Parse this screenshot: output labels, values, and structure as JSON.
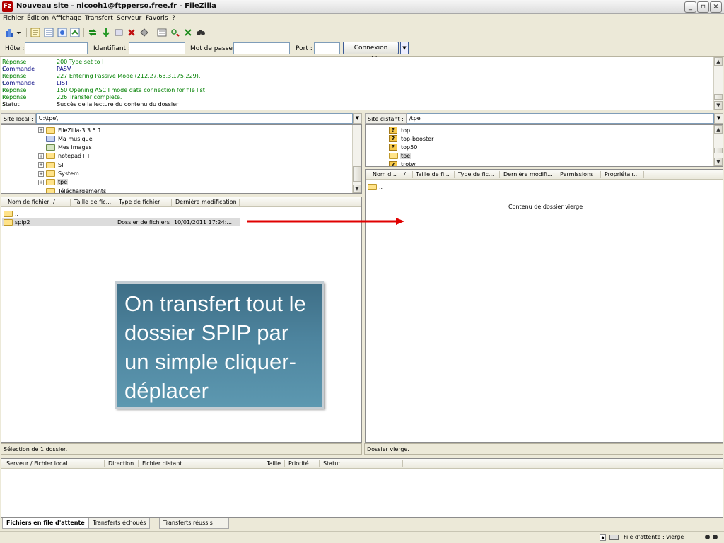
{
  "window": {
    "title": "Nouveau site - nicooh1@ftpperso.free.fr - FileZilla",
    "app_icon_letter": "Fz",
    "buttons": {
      "minimize": "_",
      "restore": "▫",
      "close": "×"
    }
  },
  "menu": [
    "Fichier",
    "Édition",
    "Affichage",
    "Transfert",
    "Serveur",
    "Favoris",
    "?"
  ],
  "toolbar_icons": [
    "site-manager-icon",
    "site-manager-dropdown-icon",
    "toggle-log-icon",
    "toggle-local-tree-icon",
    "toggle-remote-tree-icon",
    "toggle-queue-icon",
    "refresh-icon",
    "process-queue-icon",
    "cancel-icon",
    "disconnect-icon",
    "reconnect-icon",
    "filter-icon",
    "compare-icon",
    "sync-browse-icon",
    "find-icon"
  ],
  "quickconnect": {
    "host_label": "Hôte :",
    "host_value": "",
    "user_label": "Identifiant :",
    "user_value": "",
    "pass_label": "Mot de passe :",
    "pass_value": "",
    "port_label": "Port :",
    "port_value": "",
    "connect_label": "Connexion rapide"
  },
  "log": [
    {
      "type": "Réponse :",
      "msg": "200 Type set to I",
      "color": "#008000"
    },
    {
      "type": "Commande :",
      "msg": "PASV",
      "color": "#000080"
    },
    {
      "type": "Réponse :",
      "msg": "227 Entering Passive Mode (212,27,63,3,175,229).",
      "color": "#008000"
    },
    {
      "type": "Commande :",
      "msg": "LIST",
      "color": "#000080"
    },
    {
      "type": "Réponse :",
      "msg": "150 Opening ASCII mode data connection for file list",
      "color": "#008000"
    },
    {
      "type": "Réponse :",
      "msg": "226 Transfer complete.",
      "color": "#008000"
    },
    {
      "type": "Statut :",
      "msg": "Succès de la lecture du contenu du dossier",
      "color": "#000000"
    }
  ],
  "local": {
    "path_label": "Site local :",
    "path": "U:\\tpe\\",
    "tree": [
      {
        "name": "FileZilla-3.3.5.1",
        "expand": true,
        "icon": "folder"
      },
      {
        "name": "Ma musique",
        "expand": false,
        "icon": "music"
      },
      {
        "name": "Mes images",
        "expand": false,
        "icon": "images"
      },
      {
        "name": "notepad++",
        "expand": true,
        "icon": "folder"
      },
      {
        "name": "SI",
        "expand": true,
        "icon": "folder"
      },
      {
        "name": "System",
        "expand": true,
        "icon": "folder"
      },
      {
        "name": "tpe",
        "expand": true,
        "icon": "folder",
        "selected": true
      },
      {
        "name": "Téléchargements",
        "expand": false,
        "icon": "folder"
      }
    ],
    "columns": [
      "Nom de fichier",
      "/",
      "Taille de fic...",
      "Type de fichier",
      "Dernière modification"
    ],
    "files": [
      {
        "name": "..",
        "type": "",
        "date": ""
      },
      {
        "name": "spip2",
        "type": "Dossier de fichiers",
        "date": "10/01/2011  17:24:..."
      }
    ],
    "status": "Sélection de 1 dossier."
  },
  "remote": {
    "path_label": "Site distant :",
    "path": "/tpe",
    "tree": [
      {
        "name": "top"
      },
      {
        "name": "top-booster"
      },
      {
        "name": "top50"
      },
      {
        "name": "tpe",
        "selected": true
      },
      {
        "name": "trotw"
      }
    ],
    "columns": [
      "Nom d...",
      "/",
      "Taille de fi...",
      "Type de fic...",
      "Dernière modifi...",
      "Permissions",
      "Propriétair..."
    ],
    "files": [
      {
        "name": ".."
      }
    ],
    "empty_message": "Contenu de dossier vierge",
    "status": "Dossier vierge."
  },
  "queue": {
    "columns": [
      "Serveur / Fichier local",
      "Direction",
      "Fichier distant",
      "Taille",
      "Priorité",
      "Statut"
    ],
    "tabs": [
      "Fichiers en file d'attente",
      "Transferts échoués",
      "Transferts réussis"
    ],
    "status": "File d'attente : vierge"
  },
  "callout": {
    "text": "On transfert tout le dossier SPIP par un simple cliquer-déplacer"
  },
  "colors": {
    "arrow": "#e00000",
    "callout_bg": "#4a7e98",
    "log_response": "#008000",
    "log_command": "#000080"
  }
}
